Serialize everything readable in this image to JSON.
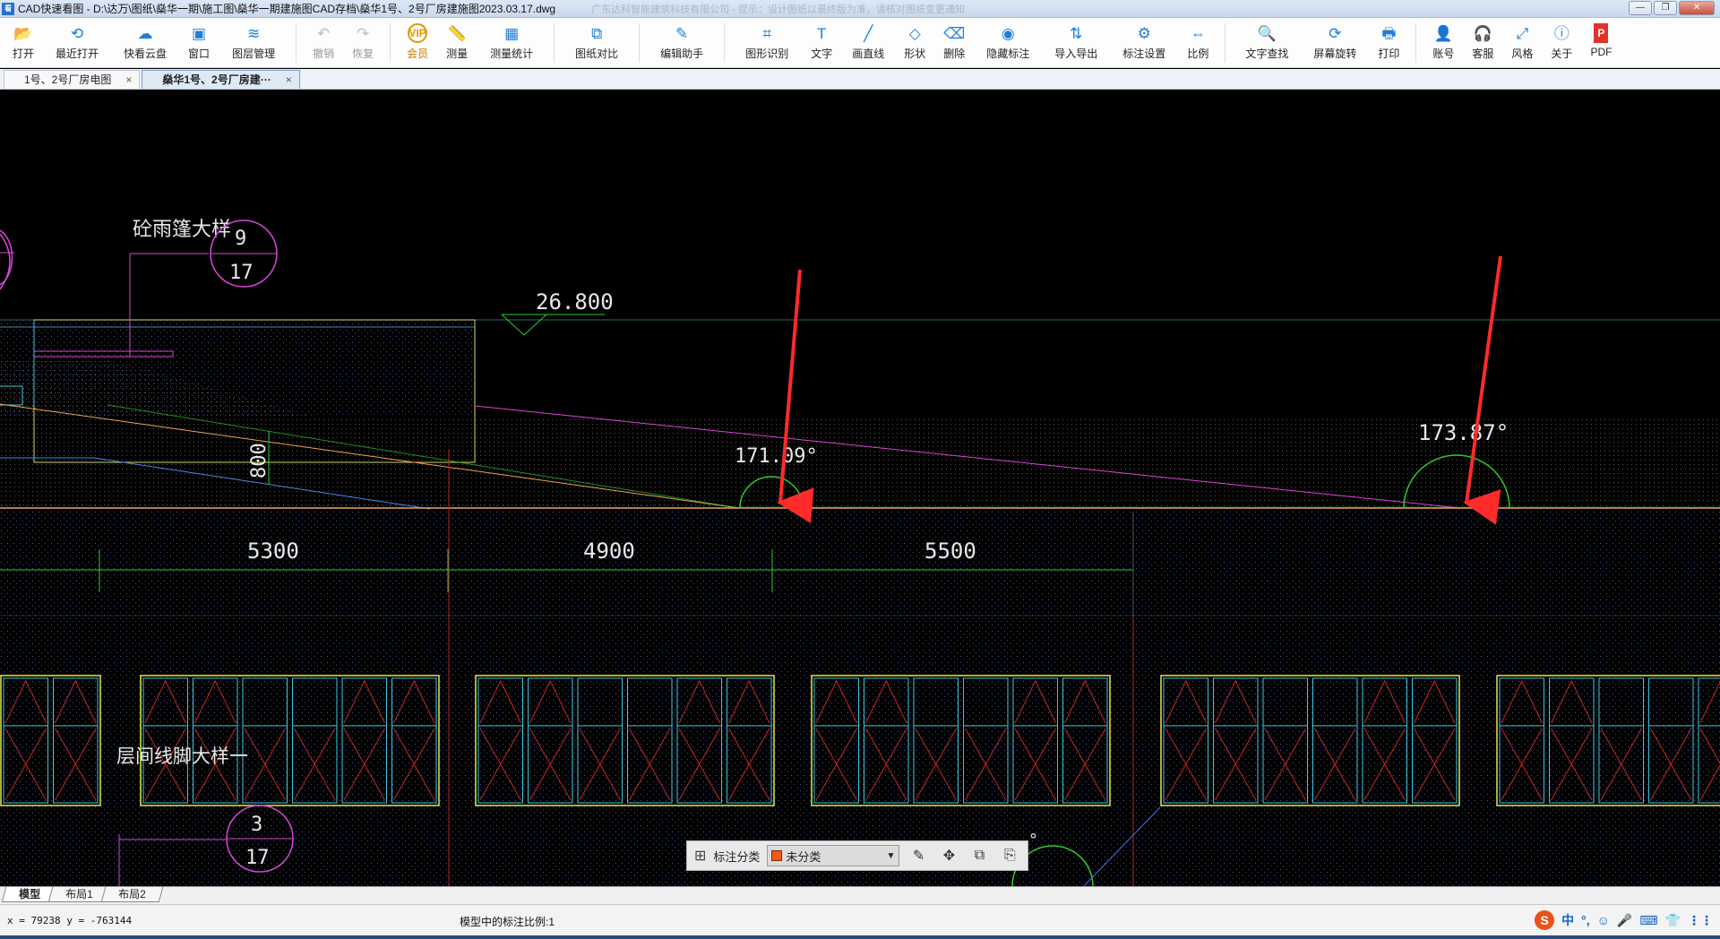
{
  "window": {
    "title": "CAD快速看图 - D:\\达万\\图纸\\燊华一期\\施工图\\燊华一期建施图CAD存档\\燊华1号、2号厂房建施图2023.03.17.dwg",
    "ghost_text": "广东达科智能建筑科技有限公司 - 提示：设计图纸以最终版为准，请核对图纸变更通知",
    "controls": [
      "—",
      "❐",
      "✕"
    ]
  },
  "toolbar": {
    "items": [
      {
        "id": "open",
        "label": "打开",
        "icon": "folder-icon",
        "glyph": "📂"
      },
      {
        "id": "recent",
        "label": "最近打开",
        "icon": "clock-icon",
        "glyph": "⟲"
      },
      {
        "id": "cloud",
        "label": "快看云盘",
        "icon": "cloud-icon",
        "glyph": "☁"
      },
      {
        "id": "window",
        "label": "窗口",
        "icon": "window-icon",
        "glyph": "▣"
      },
      {
        "id": "layers",
        "label": "图层管理",
        "icon": "layers-icon",
        "glyph": "≋"
      },
      {
        "id": "undo",
        "label": "撤销",
        "icon": "undo-icon",
        "glyph": "↶",
        "disabled": true
      },
      {
        "id": "redo",
        "label": "恢复",
        "icon": "redo-icon",
        "glyph": "↷",
        "disabled": true
      },
      {
        "id": "vip",
        "label": "会员",
        "icon": "vip-icon",
        "glyph": "VIP",
        "vip": true
      },
      {
        "id": "measure",
        "label": "测量",
        "icon": "ruler-icon",
        "glyph": "📏"
      },
      {
        "id": "measure-stats",
        "label": "测量统计",
        "icon": "stats-icon",
        "glyph": "▦"
      },
      {
        "id": "compare",
        "label": "图纸对比",
        "icon": "compare-icon",
        "glyph": "⧉"
      },
      {
        "id": "edit-helper",
        "label": "编辑助手",
        "icon": "edit-icon",
        "glyph": "✎"
      },
      {
        "id": "shape-recog",
        "label": "图形识别",
        "icon": "shape-recog-icon",
        "glyph": "⌗"
      },
      {
        "id": "text",
        "label": "文字",
        "icon": "text-icon",
        "glyph": "T"
      },
      {
        "id": "line",
        "label": "画直线",
        "icon": "line-icon",
        "glyph": "╱"
      },
      {
        "id": "shape",
        "label": "形状",
        "icon": "shape-icon",
        "glyph": "◇"
      },
      {
        "id": "erase",
        "label": "删除",
        "icon": "eraser-icon",
        "glyph": "⌫"
      },
      {
        "id": "hide-dim",
        "label": "隐藏标注",
        "icon": "eye-icon",
        "glyph": "◉"
      },
      {
        "id": "import-export",
        "label": "导入导出",
        "icon": "import-export-icon",
        "glyph": "⇅"
      },
      {
        "id": "dim-settings",
        "label": "标注设置",
        "icon": "gear-icon",
        "glyph": "⚙"
      },
      {
        "id": "scale",
        "label": "比例",
        "icon": "scale-icon",
        "glyph": "⇔"
      },
      {
        "id": "text-search",
        "label": "文字查找",
        "icon": "search-icon",
        "glyph": "🔍"
      },
      {
        "id": "rotate",
        "label": "屏幕旋转",
        "icon": "rotate-icon",
        "glyph": "⟳"
      },
      {
        "id": "print",
        "label": "打印",
        "icon": "printer-icon",
        "glyph": "🖶"
      },
      {
        "id": "account",
        "label": "账号",
        "icon": "user-icon",
        "glyph": "👤"
      },
      {
        "id": "service",
        "label": "客服",
        "icon": "headset-icon",
        "glyph": "🎧"
      },
      {
        "id": "style",
        "label": "风格",
        "icon": "style-icon",
        "glyph": "⤢"
      },
      {
        "id": "about",
        "label": "关于",
        "icon": "info-icon",
        "glyph": "ⓘ"
      },
      {
        "id": "pdf",
        "label": "PDF",
        "icon": "pdf-icon",
        "glyph": "P"
      }
    ]
  },
  "tabs": [
    {
      "label": "1号、2号厂房电图",
      "close": "×",
      "active": false
    },
    {
      "label": "燊华1号、2号厂房建···",
      "close": "×",
      "active": true
    }
  ],
  "drawing": {
    "texts": {
      "canopy_detail": "砼雨篷大样",
      "canopy_bubble_top": "9",
      "canopy_bubble_bottom": "17",
      "elevation": "26.800",
      "thickness": "800",
      "angle_1": "171.09°",
      "angle_2": "173.87°",
      "dim_1": "5300",
      "dim_2": "4900",
      "dim_3": "5500",
      "floor_detail": "层间线脚大样一",
      "floor_bubble_top": "3",
      "floor_bubble_bottom": "17",
      "partial_degree": "°"
    },
    "colors": {
      "background": "#000000",
      "magenta": "#d946d9",
      "yellow": "#e6e64c",
      "cyan": "#3cc8dc",
      "red": "#e02828",
      "green": "#2ecc2e",
      "white": "#e8e8e8",
      "blue": "#4a6ae6",
      "orange": "#f0a25a",
      "arrow": "#ff2a2a"
    }
  },
  "annotation_bar": {
    "label": "标注分类",
    "selected": "未分类",
    "swatch_color": "#f05a14",
    "tools": [
      "edit-icon",
      "move-icon",
      "copy-icon",
      "paste-icon"
    ]
  },
  "layout_tabs": [
    {
      "label": "模型",
      "active": true
    },
    {
      "label": "布局1",
      "active": false
    },
    {
      "label": "布局2",
      "active": false
    }
  ],
  "status": {
    "coords": "x = 79238   y = -763144",
    "scale_text": "模型中的标注比例:1"
  },
  "ime": {
    "logo": "S",
    "mode": "中",
    "icons": [
      "°,",
      "☺",
      "🎤",
      "⌨",
      "👕",
      "⋮⋮"
    ]
  }
}
